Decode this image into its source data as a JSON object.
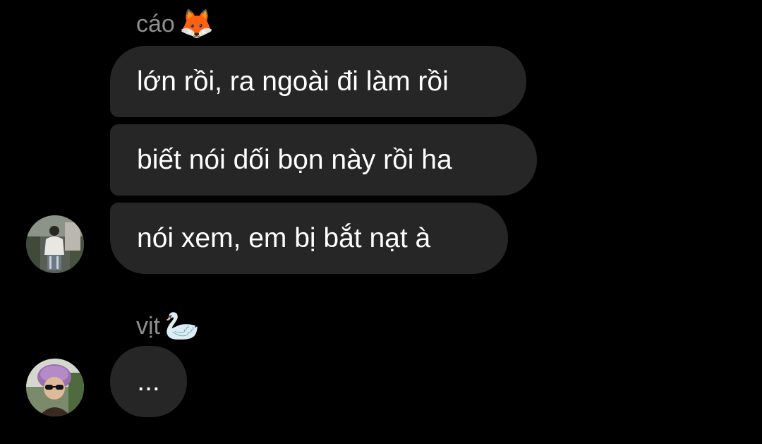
{
  "thread": [
    {
      "sender": {
        "name": "cáo",
        "emoji": "🦊",
        "emoji_name": "fox-emoji"
      },
      "messages": [
        "lớn rồi, ra ngoài đi làm rồi",
        "biết nói dối bọn này rồi ha",
        "nói xem, em bị bắt nạt à"
      ],
      "avatar": "avatar-photo-person-standing"
    },
    {
      "sender": {
        "name": "vịt",
        "emoji": "🦢",
        "emoji_name": "swan-emoji"
      },
      "messages": [
        "..."
      ],
      "avatar": "avatar-photo-person-fur-hat"
    }
  ],
  "colors": {
    "background": "#000000",
    "bubble": "#262626",
    "sender_label": "#8e8e8e",
    "message_text": "#ffffff"
  }
}
